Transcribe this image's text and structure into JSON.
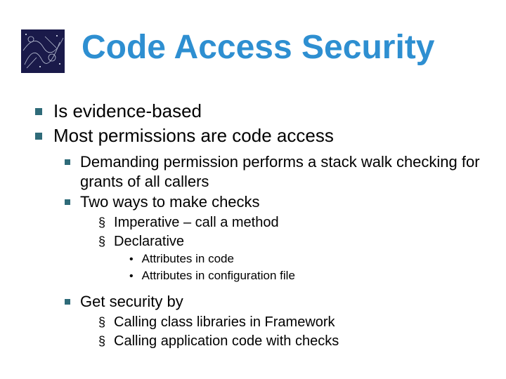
{
  "title": "Code Access Security",
  "bullets": {
    "l1_0": "Is evidence-based",
    "l1_1": "Most permissions are code access",
    "l2_0": "Demanding permission performs a stack walk checking for grants of all callers",
    "l2_1": "Two ways to make checks",
    "l3_0": "Imperative – call a method",
    "l3_1": "Declarative",
    "l4_0": "Attributes in code",
    "l4_1": "Attributes in configuration file",
    "l2_2": "Get security by",
    "l3_2": "Calling class libraries in Framework",
    "l3_3": "Calling application code with checks"
  },
  "glyphs": {
    "section": "§",
    "dot": "•"
  }
}
